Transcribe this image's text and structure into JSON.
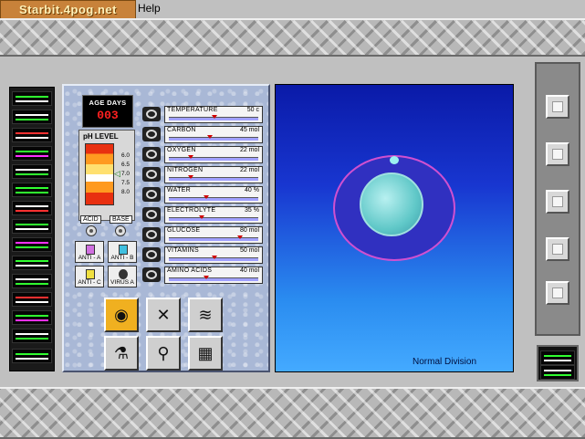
{
  "watermark": "Starbit.4pog.net",
  "menu": {
    "help": "Help"
  },
  "age": {
    "label": "AGE DAYS",
    "value": "003"
  },
  "ph": {
    "label": "pH LEVEL",
    "ticks": [
      "6.0",
      "6.5",
      "7.0",
      "7.5",
      "8.0"
    ],
    "current": 7.0,
    "acid_label": "ACID",
    "base_label": "BASE"
  },
  "anti_buttons": [
    {
      "label": "ANTI - A"
    },
    {
      "label": "ANTI - B"
    },
    {
      "label": "ANTI - C"
    },
    {
      "label": "VIRUS A"
    }
  ],
  "meters": [
    {
      "name": "TEMPERATURE",
      "value": "50 c",
      "level": 0.5
    },
    {
      "name": "CARBON",
      "value": "45 mol",
      "level": 0.45
    },
    {
      "name": "OXYGEN",
      "value": "22 mol",
      "level": 0.22
    },
    {
      "name": "NITROGEN",
      "value": "22 mol",
      "level": 0.22
    },
    {
      "name": "WATER",
      "value": "40 %",
      "level": 0.4
    },
    {
      "name": "ELECTROLYTE",
      "value": "35 %",
      "level": 0.35
    },
    {
      "name": "GLUCOSE",
      "value": "80 mol",
      "level": 0.8
    },
    {
      "name": "VITAMINS",
      "value": "50 mol",
      "level": 0.5
    },
    {
      "name": "AMINO ACIDS",
      "value": "40 mol",
      "level": 0.4
    }
  ],
  "tools": [
    {
      "icon": "cell-icon",
      "active": true
    },
    {
      "icon": "chromosome-icon",
      "active": false
    },
    {
      "icon": "dna-icon",
      "active": false
    },
    {
      "icon": "beaker-icon",
      "active": false
    },
    {
      "icon": "microscope-icon",
      "active": false
    },
    {
      "icon": "monitor-icon",
      "active": false
    }
  ],
  "viewer": {
    "caption": "Normal Division"
  },
  "colors": {
    "viewer_top": "#0a1aa8",
    "viewer_bottom": "#44aaff",
    "membrane": "#d050d0",
    "accent": "#f0b020"
  }
}
